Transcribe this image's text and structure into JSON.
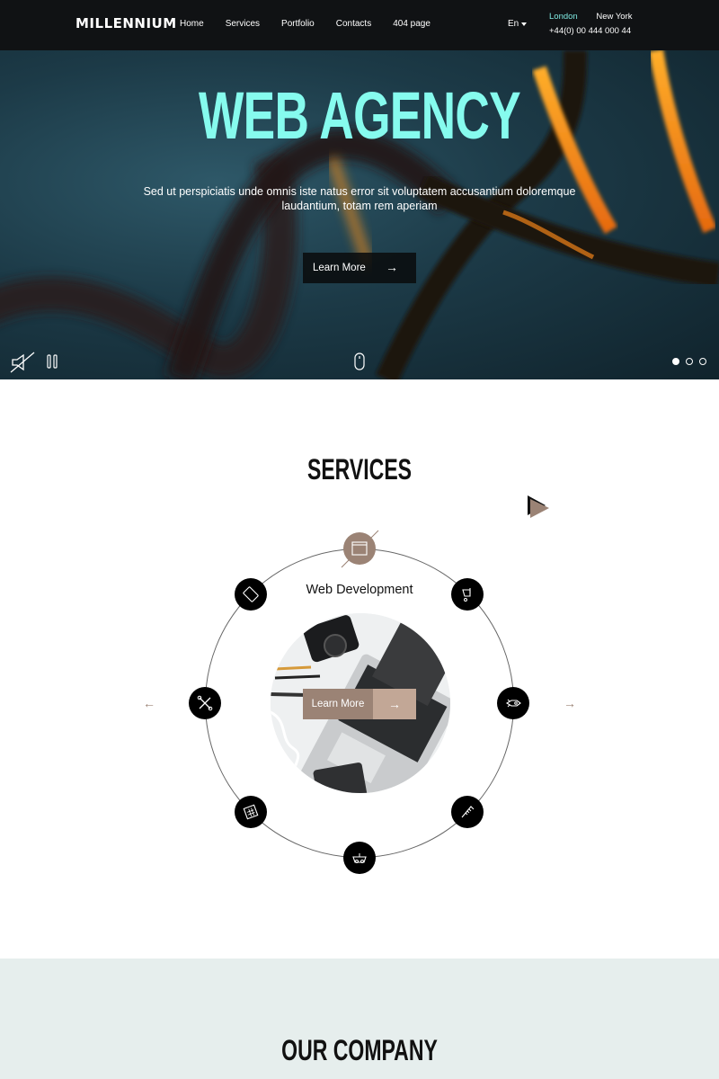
{
  "header": {
    "logo": "MILLENNIUM",
    "nav": [
      {
        "label": "Home"
      },
      {
        "label": "Services"
      },
      {
        "label": "Portfolio"
      },
      {
        "label": "Contacts"
      },
      {
        "label": "404 page"
      }
    ],
    "language": "En",
    "cities": {
      "active": "London",
      "other": "New York"
    },
    "phone": "+44(0) 00 444 000 44"
  },
  "hero": {
    "title": "WEB AGENCY",
    "subtitle": "Sed ut perspiciatis unde omnis iste natus error sit voluptatem accusantium doloremque laudantium, totam rem aperiam",
    "button_label": "Learn More",
    "button_arrow": "→",
    "slides": {
      "count": 3,
      "active": 1
    },
    "accent_color": "#86fbee"
  },
  "services": {
    "title": "SERVICES",
    "active_service": "Web Development",
    "button_label": "Learn More",
    "button_arrow": "→",
    "prev_arrow": "←",
    "next_arrow": "→",
    "accent_color": "#9b8375",
    "icons": [
      "browser-window-icon",
      "paint-bucket-icon",
      "rocket-icon",
      "ruler-icon",
      "gamepad-icon",
      "calculator-icon",
      "tools-icon",
      "tablet-icon"
    ]
  },
  "company": {
    "title": "OUR COMPANY",
    "background": "#e6eeed"
  }
}
